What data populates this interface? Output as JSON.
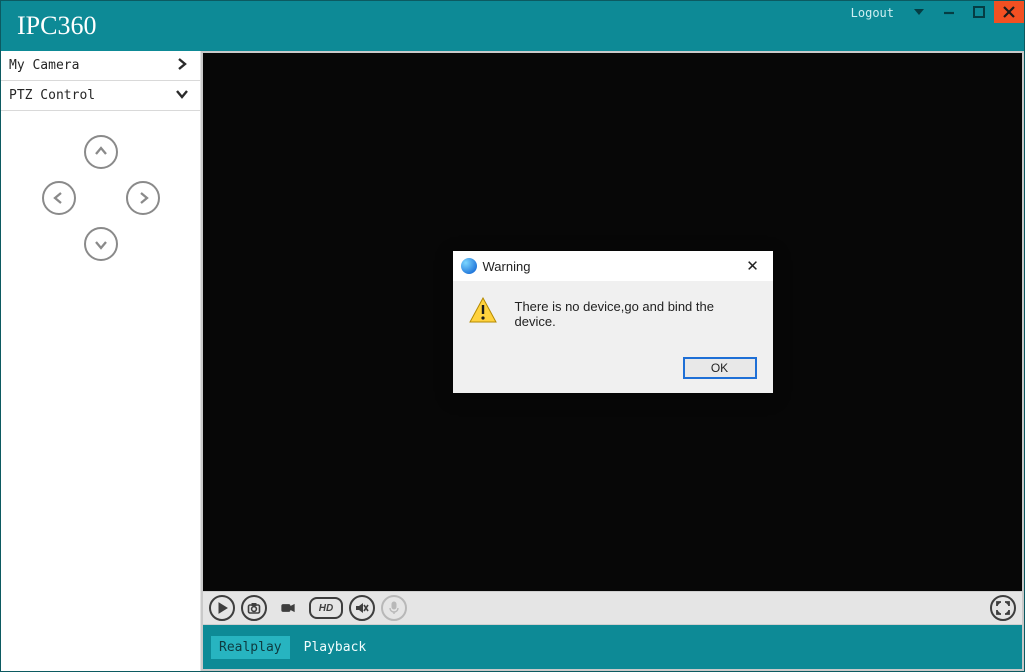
{
  "app": {
    "title": "IPC360"
  },
  "titlebar": {
    "logout": "Logout"
  },
  "sidebar": {
    "items": [
      {
        "label": "My Camera",
        "expanded": false
      },
      {
        "label": "PTZ Control",
        "expanded": true
      }
    ]
  },
  "toolbar": {
    "hd_label": "HD"
  },
  "tabs": {
    "realplay": "Realplay",
    "playback": "Playback",
    "active": "realplay"
  },
  "dialog": {
    "title": "Warning",
    "message": "There is no device,go and bind the device.",
    "ok": "OK"
  }
}
